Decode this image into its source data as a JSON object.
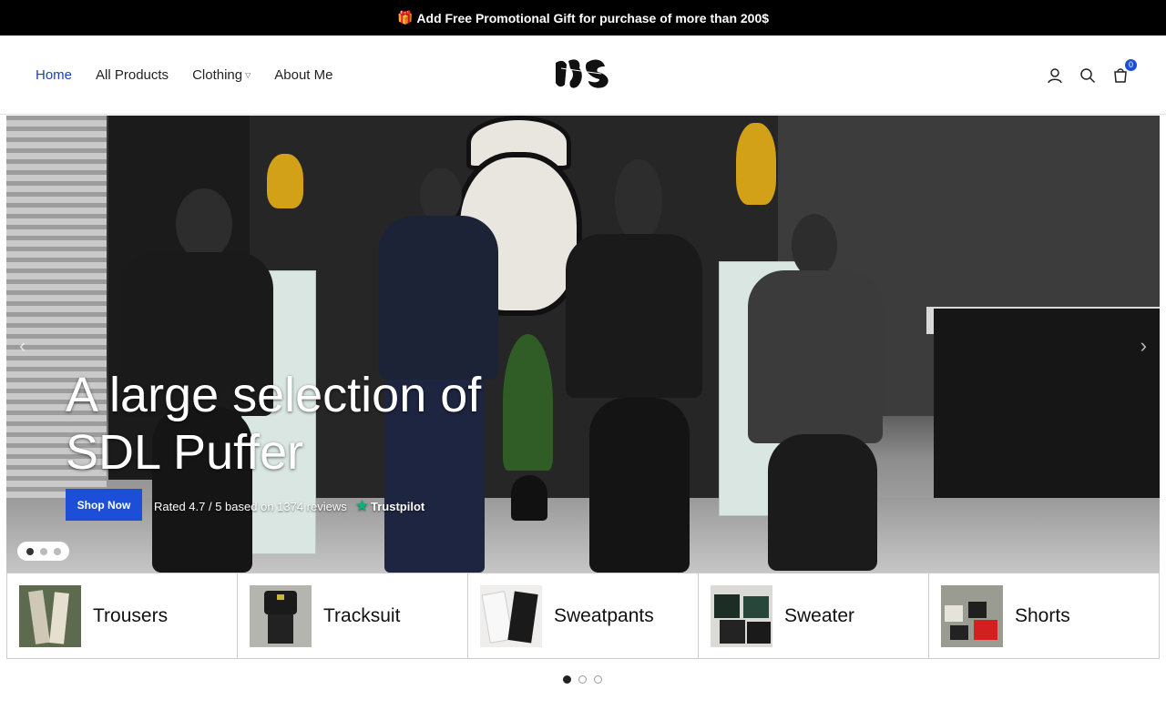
{
  "announcement": {
    "icon": "gift-icon",
    "text": "Add Free Promotional Gift for purchase of more than 200$"
  },
  "nav": {
    "items": [
      {
        "label": "Home",
        "active": true
      },
      {
        "label": "All Products",
        "active": false
      },
      {
        "label": "Clothing",
        "active": false,
        "has_dropdown": true
      },
      {
        "label": "About Me",
        "active": false
      }
    ]
  },
  "header": {
    "logo": "logo-icon",
    "cart_count": "0",
    "icons": [
      "account-icon",
      "search-icon",
      "cart-icon"
    ]
  },
  "hero": {
    "title": "A large selection of SDL Puffer",
    "button_label": "Shop Now",
    "rating_text": "Rated 4.7 / 5 based on 1374 reviews",
    "trustpilot_label": "Trustpilot",
    "slide_count": 3,
    "active_slide": 1
  },
  "categories": [
    {
      "label": "Trousers"
    },
    {
      "label": "Tracksuit"
    },
    {
      "label": "Sweatpants"
    },
    {
      "label": "Sweater"
    },
    {
      "label": "Shorts"
    }
  ],
  "pager": {
    "count": 3,
    "active": 1
  },
  "colors": {
    "accent": "#1d4ed8",
    "nav_active": "#1f3fb8",
    "trustpilot": "#00b67a"
  }
}
